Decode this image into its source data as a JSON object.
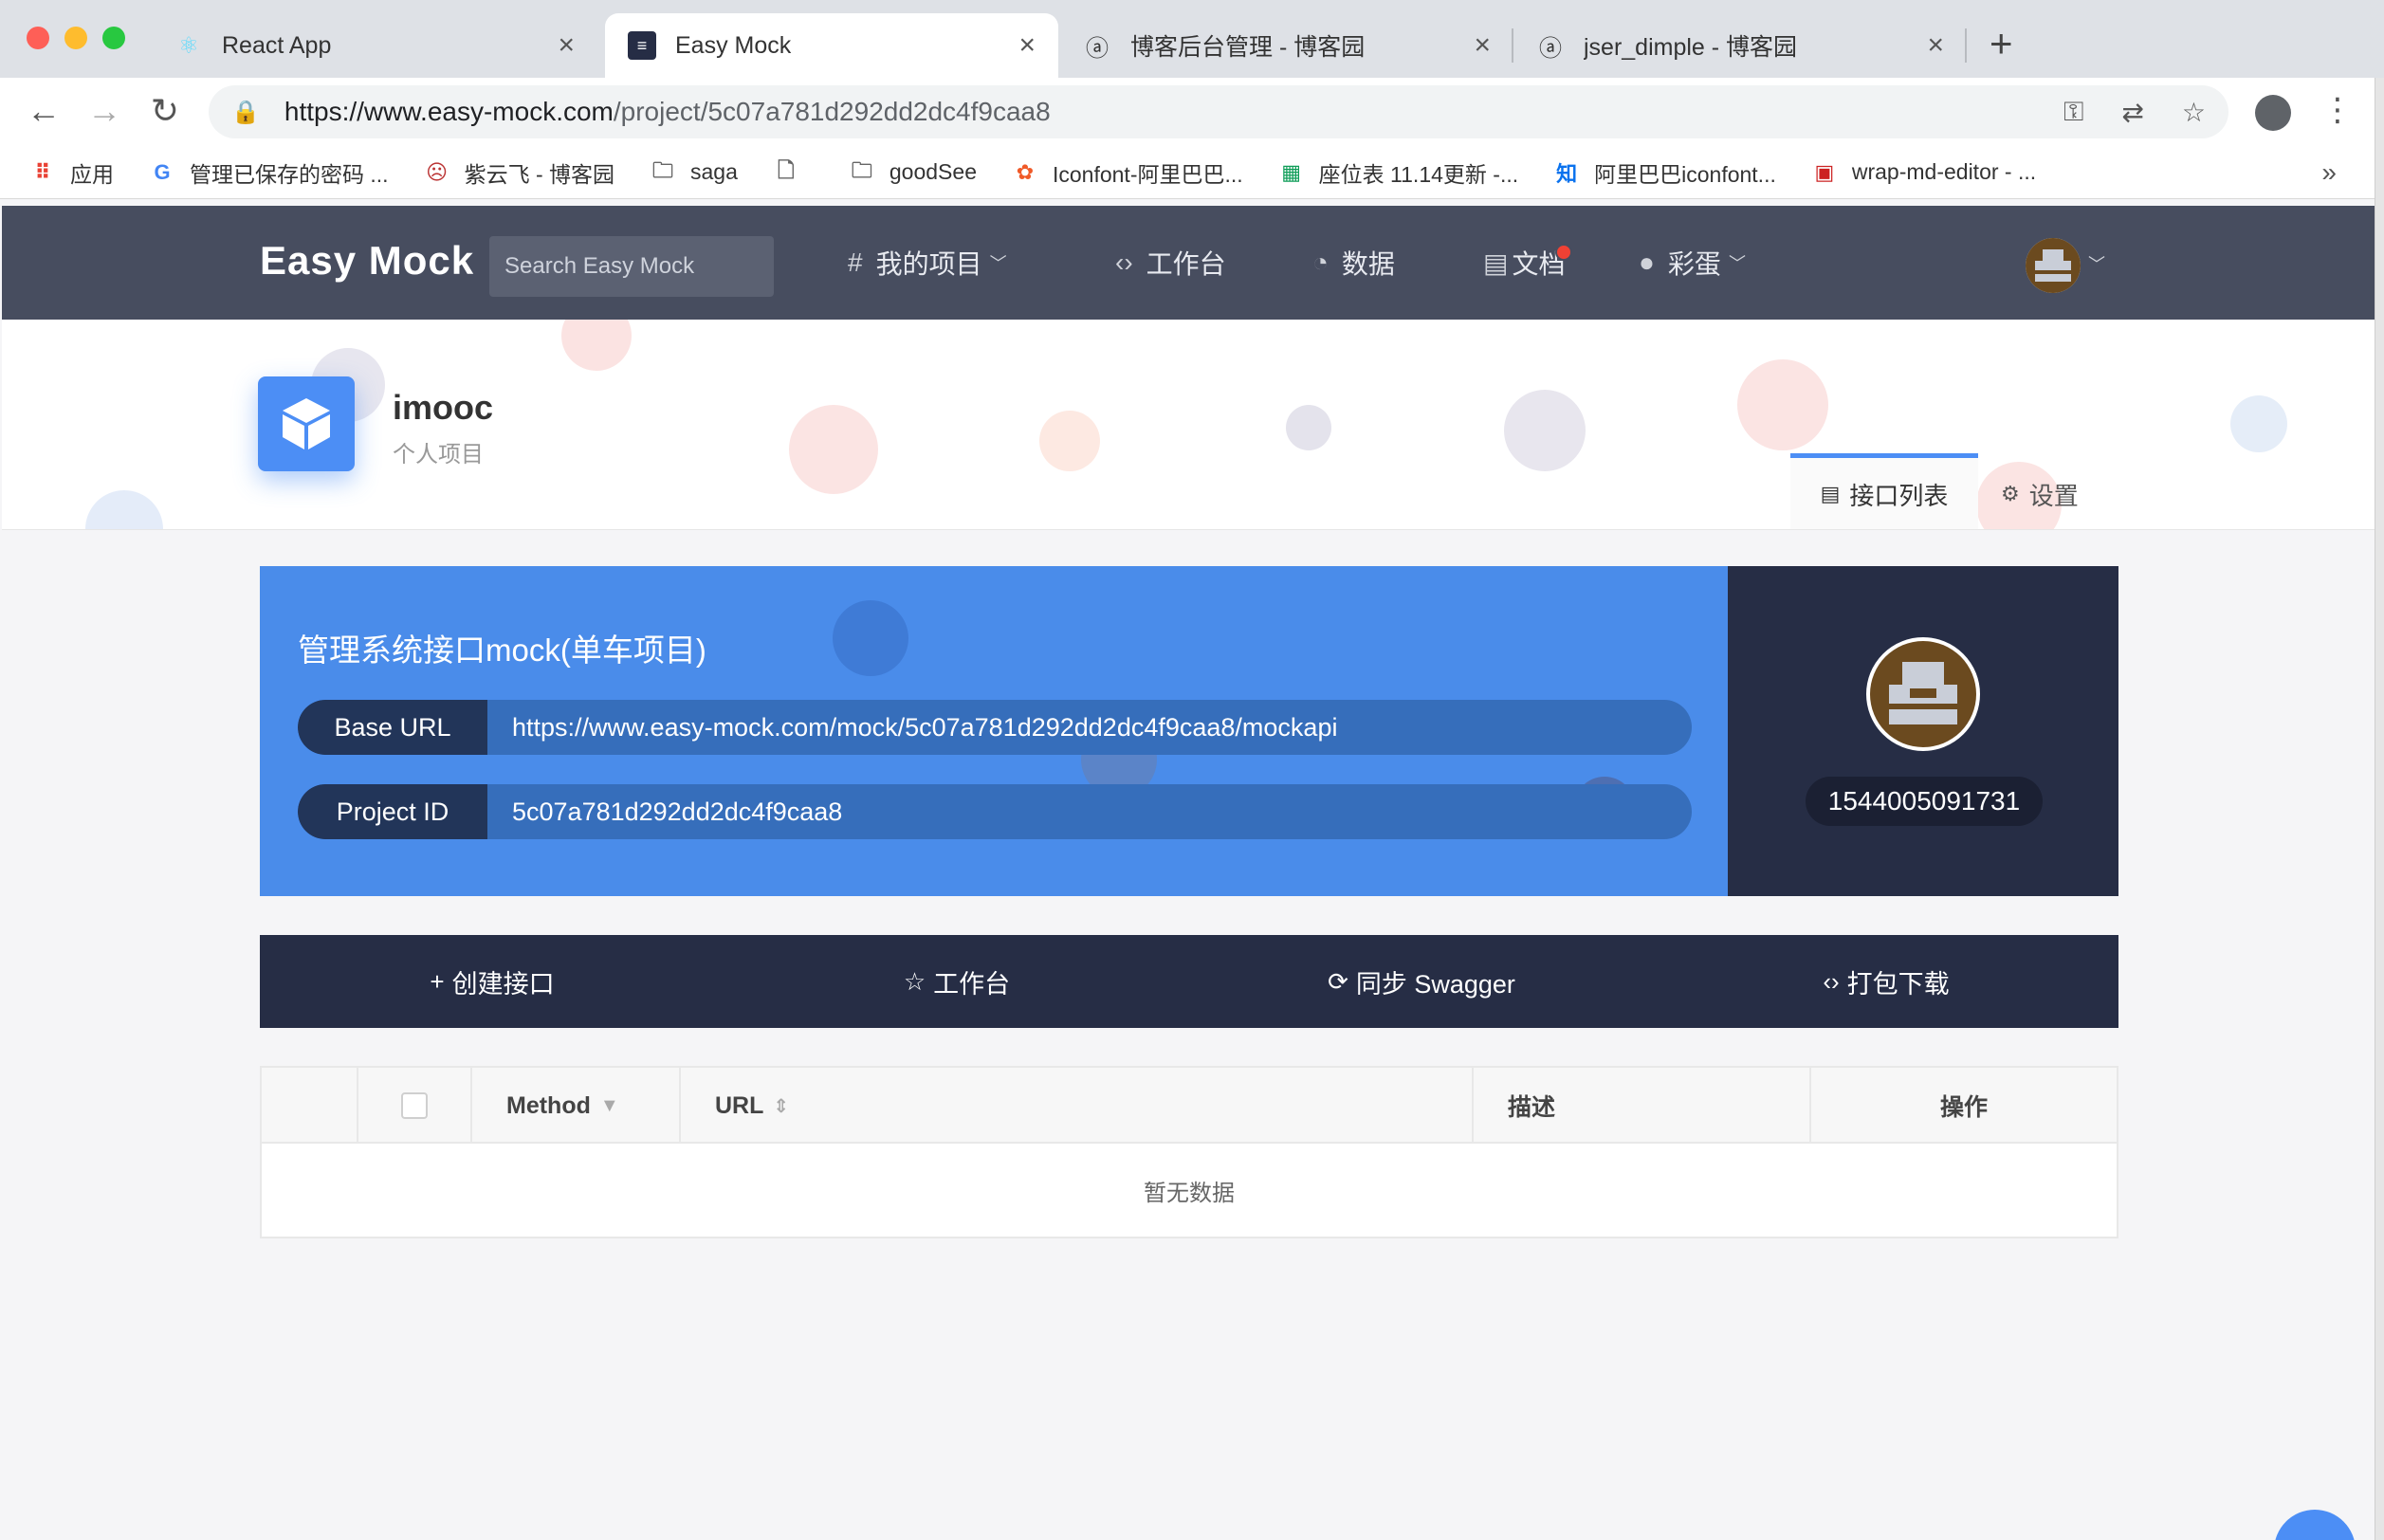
{
  "browser": {
    "tabs": [
      {
        "title": "React App",
        "icon": "react-icon",
        "active": false
      },
      {
        "title": "Easy Mock",
        "icon": "easy-mock-icon",
        "active": true
      },
      {
        "title": "博客后台管理 - 博客园",
        "icon": "cnblogs-icon",
        "active": false
      },
      {
        "title": "jser_dimple - 博客园",
        "icon": "cnblogs-icon",
        "active": false
      }
    ],
    "new_tab": "+",
    "url_host": "https://www.easy-mock.com",
    "url_path": "/project/5c07a781d292dd2dc4f9caa8",
    "bookmarks": [
      {
        "label": "应用",
        "icon": "apps-grid-icon",
        "color": "#e94235"
      },
      {
        "label": "管理已保存的密码 ...",
        "icon": "google-icon",
        "color": "#4285f4"
      },
      {
        "label": "紫云飞 - 博客园",
        "icon": "face-icon",
        "color": "#b33"
      },
      {
        "label": "saga",
        "icon": "folder-icon",
        "color": "#666"
      },
      {
        "label": "",
        "icon": "page-icon",
        "color": "#666"
      },
      {
        "label": "goodSee",
        "icon": "folder-icon",
        "color": "#666"
      },
      {
        "label": "Iconfont-阿里巴巴...",
        "icon": "iconfont-icon",
        "color": "#f05a28"
      },
      {
        "label": "座位表 11.14更新 -...",
        "icon": "sheets-icon",
        "color": "#0f9d58"
      },
      {
        "label": "阿里巴巴iconfont...",
        "icon": "zhihu-icon",
        "color": "#0a72ee"
      },
      {
        "label": "wrap-md-editor - ...",
        "icon": "md-icon",
        "color": "#cc2222"
      }
    ],
    "bookmarks_more": "»"
  },
  "header": {
    "logo": "Easy Mock",
    "search_placeholder": "Search Easy Mock",
    "nav": [
      {
        "label": "我的项目",
        "icon": "#",
        "caret": true
      },
      {
        "label": "工作台",
        "icon": "‹›",
        "caret": false
      },
      {
        "label": "数据",
        "icon": "◔",
        "caret": false
      },
      {
        "label": "文档",
        "icon": "▤",
        "caret": false
      },
      {
        "label": "彩蛋",
        "icon": "●",
        "caret": true
      }
    ]
  },
  "project": {
    "name": "imooc",
    "type": "个人项目",
    "tabs": {
      "api_list": "接口列表",
      "settings": "设置"
    }
  },
  "info": {
    "title": "管理系统接口mock(单车项目)",
    "base_url_label": "Base URL",
    "base_url": "https://www.easy-mock.com/mock/5c07a781d292dd2dc4f9caa8/mockapi",
    "project_id_label": "Project ID",
    "project_id": "5c07a781d292dd2dc4f9caa8",
    "user_id": "1544005091731"
  },
  "actions": {
    "create": "创建接口",
    "workbench": "工作台",
    "sync": "同步 Swagger",
    "download": "打包下载"
  },
  "table": {
    "columns": {
      "method": "Method",
      "url": "URL",
      "desc": "描述",
      "ops": "操作"
    },
    "empty_text": "暂无数据"
  },
  "colors": {
    "header_bg": "#474d5f",
    "accent": "#4c8ef5",
    "dark_navy": "#262d45"
  }
}
